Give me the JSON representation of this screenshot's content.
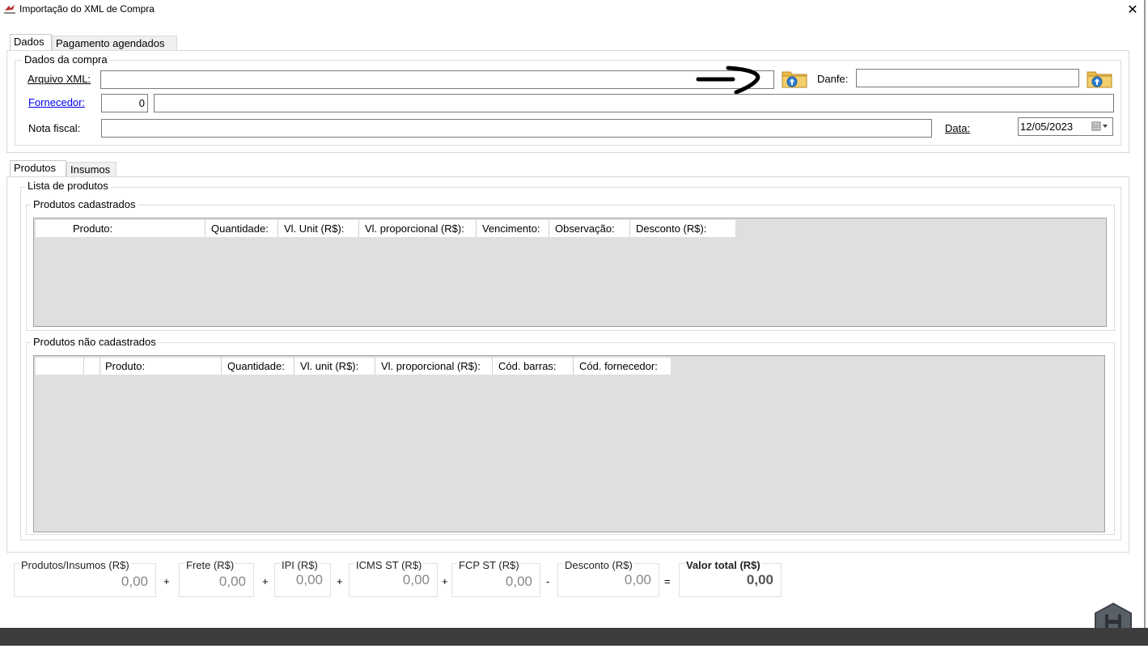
{
  "window": {
    "title": "Importação do XML de Compra",
    "close_glyph": "✕"
  },
  "top_tabs": [
    "Dados",
    "Pagamento agendados"
  ],
  "dados_compra": {
    "title": "Dados da compra",
    "arquivo_xml_label": "Arquivo XML:",
    "arquivo_xml_value": "",
    "danfe_label": "Danfe:",
    "danfe_value": "",
    "fornecedor_label": "Fornecedor:",
    "fornecedor_code": "0",
    "fornecedor_name": "",
    "nota_fiscal_label": "Nota fiscal:",
    "nota_fiscal_value": "",
    "data_label": "Data:",
    "data_value": "12/05/2023"
  },
  "product_tabs": [
    "Produtos",
    "Insumos"
  ],
  "lista": {
    "title": "Lista de produtos",
    "cadastrados": {
      "title": "Produtos cadastrados",
      "columns": [
        "Produto:",
        "Quantidade:",
        "Vl. Unit (R$):",
        "Vl. proporcional (R$):",
        "Vencimento:",
        "Observação:",
        "Desconto (R$):"
      ],
      "rows": []
    },
    "nao_cadastrados": {
      "title": "Produtos não cadastrados",
      "columns": [
        "",
        "",
        "Produto:",
        "Quantidade:",
        "Vl. unit (R$):",
        "Vl. proporcional (R$):",
        "Cód. barras:",
        "Cód. fornecedor:"
      ],
      "rows": []
    }
  },
  "totals": [
    {
      "label": "Produtos/Insumos (R$)",
      "value": "0,00"
    },
    {
      "label": "Frete (R$)",
      "value": "0,00"
    },
    {
      "label": "IPI (R$)",
      "value": "0,00"
    },
    {
      "label": "ICMS ST (R$)",
      "value": "0,00"
    },
    {
      "label": "FCP ST (R$)",
      "value": "0,00"
    },
    {
      "label": "Desconto (R$)",
      "value": "0,00"
    },
    {
      "label": "Valor total (R$)",
      "value": "0,00"
    }
  ],
  "operators": [
    "+",
    "+",
    "+",
    "+",
    "-",
    "="
  ],
  "icons": {
    "app": "app-logo-icon",
    "open_file": "folder-upload-icon",
    "calendar": "calendar-icon",
    "save": "save-icon"
  },
  "colors": {
    "grid_bg": "#dfdfdf",
    "link": "#0000ee",
    "save_hex": "#5a6068",
    "bottom_bar": "#3c3c3c"
  }
}
